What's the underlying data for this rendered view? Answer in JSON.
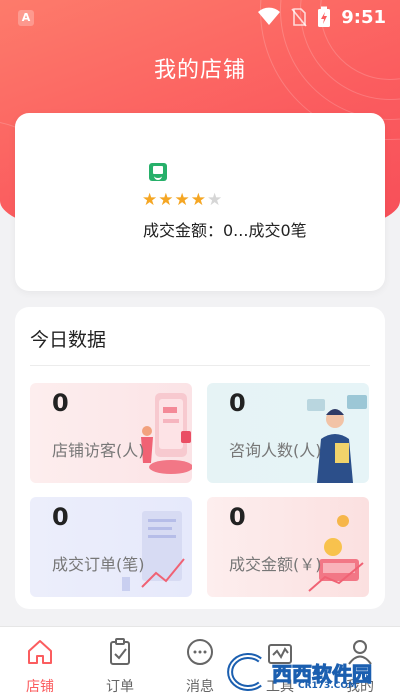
{
  "status_bar": {
    "app_icon": "A",
    "time": "9:51",
    "icons": [
      "wifi-icon",
      "no-sim-icon",
      "battery-charging-icon"
    ]
  },
  "header": {
    "title": "我的店铺"
  },
  "store": {
    "logo_icon": "store-logo-icon",
    "rating": 4,
    "rating_max": 5,
    "stat_text": "成交金额：0...成交0笔"
  },
  "today": {
    "heading": "今日数据",
    "tiles": [
      {
        "value": "0",
        "label": "店铺访客(人)"
      },
      {
        "value": "0",
        "label": "咨询人数(人)"
      },
      {
        "value": "0",
        "label": "成交订单(笔)"
      },
      {
        "value": "0",
        "label": "成交金额(￥)"
      }
    ]
  },
  "tabbar": {
    "active": 0,
    "accent": "#fb5d5f",
    "items": [
      {
        "label": "店铺",
        "icon": "home-icon"
      },
      {
        "label": "订单",
        "icon": "clipboard-check-icon"
      },
      {
        "label": "消息",
        "icon": "message-icon"
      },
      {
        "label": "工具",
        "icon": "toolbox-icon"
      },
      {
        "label": "我的",
        "icon": "user-icon"
      }
    ]
  },
  "watermark": {
    "text": "西西软件园",
    "url": "CR173.COM"
  }
}
